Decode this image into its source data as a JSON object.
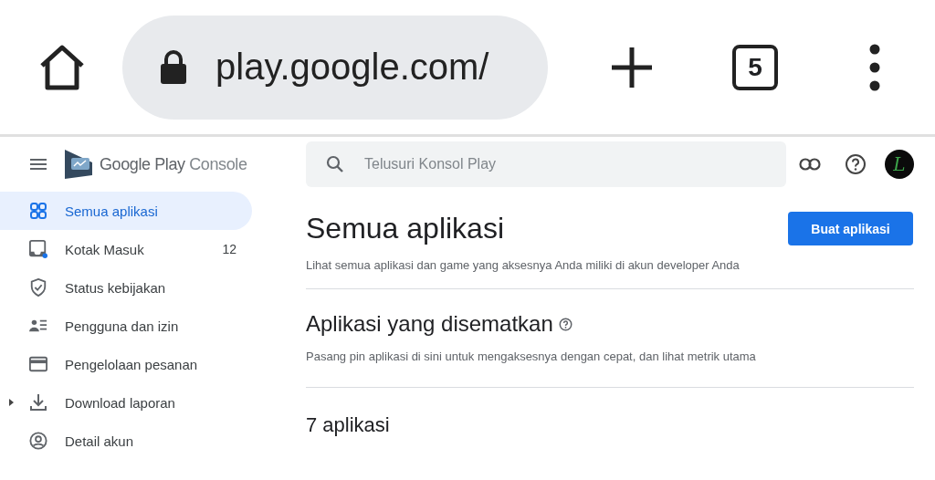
{
  "browser": {
    "url": "play.google.com/",
    "tab_count": "5"
  },
  "header": {
    "logo_text": "Google Play",
    "logo_suffix": "Console",
    "search": {
      "placeholder": "Telusuri Konsol Play"
    },
    "avatar_letter": "L"
  },
  "sidebar": {
    "items": [
      {
        "label": "Semua aplikasi",
        "expandable": false,
        "selected": true
      },
      {
        "label": "Kotak Masuk",
        "count": "12",
        "expandable": false,
        "selected": false
      },
      {
        "label": "Status kebijakan",
        "expandable": false,
        "selected": false
      },
      {
        "label": "Pengguna dan izin",
        "expandable": false,
        "selected": false
      },
      {
        "label": "Pengelolaan pesanan",
        "expandable": false,
        "selected": false
      },
      {
        "label": "Download laporan",
        "expandable": true,
        "selected": false
      },
      {
        "label": "Detail akun",
        "expandable": false,
        "selected": false
      }
    ]
  },
  "main": {
    "title": "Semua aplikasi",
    "create_button": "Buat aplikasi",
    "subtitle": "Lihat semua aplikasi dan game yang aksesnya Anda miliki di akun developer Anda",
    "pinned": {
      "title": "Aplikasi yang disematkan",
      "description": "Pasang pin aplikasi di sini untuk mengaksesnya dengan cepat, dan lihat metrik utama"
    },
    "app_count": "7 aplikasi"
  }
}
